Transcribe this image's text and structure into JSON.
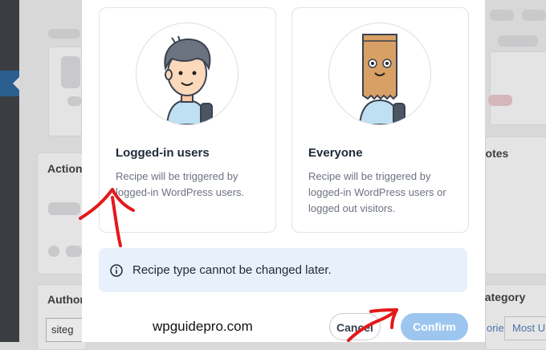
{
  "background": {
    "labels": {
      "actions": "Action",
      "notes": "notes",
      "author": "Author",
      "category": "category",
      "author_input": "siteg",
      "categories_link": "ories",
      "most_used_link": "Most U"
    }
  },
  "modal": {
    "options": [
      {
        "title": "Logged-in users",
        "description": "Recipe will be triggered by logged-in WordPress users."
      },
      {
        "title": "Everyone",
        "description": "Recipe will be triggered by logged-in WordPress users or logged out visitors."
      }
    ],
    "notice_text": "Recipe type cannot be changed later.",
    "cancel_label": "Cancel",
    "confirm_label": "Confirm"
  },
  "watermark": "wpguidepro.com",
  "colors": {
    "confirm_bg": "#9cc6ef",
    "notice_bg": "#e8f0fb",
    "annotation_red": "#e3191b"
  }
}
